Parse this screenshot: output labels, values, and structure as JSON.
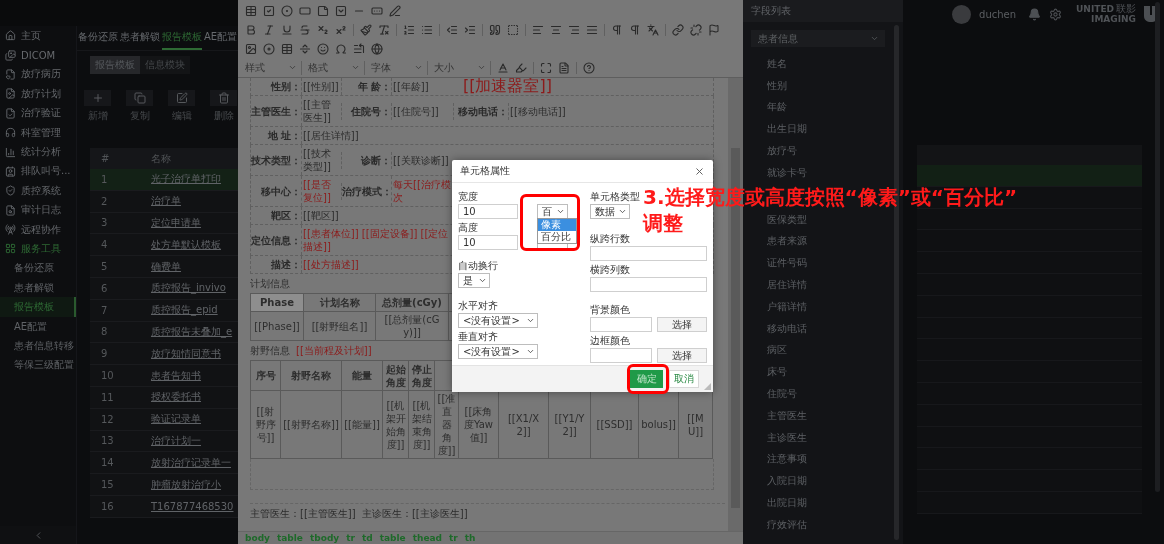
{
  "topbar": {
    "username": "duchen",
    "logo_top": "UNITED",
    "logo_cn": "联影",
    "logo_bottom": "IMAGING"
  },
  "nav": [
    {
      "label": "主页",
      "selected": false
    },
    {
      "label": "DICOM",
      "selected": false
    },
    {
      "label": "放疗病历",
      "selected": false
    },
    {
      "label": "放疗计划",
      "selected": false
    },
    {
      "label": "治疗验证",
      "selected": false
    },
    {
      "label": "科室管理",
      "selected": false
    },
    {
      "label": "统计分析",
      "selected": false
    },
    {
      "label": "排队叫号...",
      "selected": false
    },
    {
      "label": "质控系统",
      "selected": false
    },
    {
      "label": "审计日志",
      "selected": false
    },
    {
      "label": "远程协作",
      "selected": false
    },
    {
      "label": "服务工具",
      "selected": true,
      "children": [
        {
          "label": "备份还原",
          "selected": false
        },
        {
          "label": "患者解锁",
          "selected": false
        },
        {
          "label": "报告模板",
          "selected": true
        },
        {
          "label": "AE配置",
          "selected": false
        },
        {
          "label": "患者信息转移",
          "selected": false
        },
        {
          "label": "等保三级配置",
          "selected": false
        }
      ]
    }
  ],
  "tabs": [
    {
      "label": "备份还原",
      "selected": false
    },
    {
      "label": "患者解锁",
      "selected": false
    },
    {
      "label": "报告模板",
      "selected": true
    },
    {
      "label": "AE配置",
      "selected": false
    }
  ],
  "subtabs": [
    {
      "label": "报告模板",
      "selected": true
    },
    {
      "label": "信息模块",
      "selected": false
    }
  ],
  "actions": [
    "新增",
    "复制",
    "编辑",
    "删除"
  ],
  "template_table": {
    "columns": [
      "#",
      "名称"
    ],
    "rows": [
      {
        "index": "1",
        "name": "光子治疗单打印",
        "selected": true
      },
      {
        "index": "2",
        "name": "治疗单",
        "selected": false
      },
      {
        "index": "3",
        "name": "定位申请单",
        "selected": false
      },
      {
        "index": "4",
        "name": "处方单默认模板",
        "selected": false
      },
      {
        "index": "5",
        "name": "确费单",
        "selected": false
      },
      {
        "index": "6",
        "name": "质控报告_invivo",
        "selected": false
      },
      {
        "index": "7",
        "name": "质控报告_epid",
        "selected": false
      },
      {
        "index": "8",
        "name": "质控报告未叠加_e",
        "selected": false
      },
      {
        "index": "9",
        "name": "放疗知情同意书",
        "selected": false
      },
      {
        "index": "10",
        "name": "患者告知书",
        "selected": false
      },
      {
        "index": "11",
        "name": "授权委托书",
        "selected": false
      },
      {
        "index": "12",
        "name": "验证记录单",
        "selected": false
      },
      {
        "index": "13",
        "name": "治疗计划一",
        "selected": false
      },
      {
        "index": "14",
        "name": "放射治疗记录单一",
        "selected": false
      },
      {
        "index": "15",
        "name": "肿瘤放射治疗小",
        "selected": false
      },
      {
        "index": "16",
        "name": "T167877468530",
        "selected": false
      }
    ]
  },
  "editor": {
    "format_menus": [
      "样式",
      "格式",
      "字体",
      "大小"
    ],
    "info_rows": [
      {
        "cells": [
          {
            "kind": "field",
            "label": "性别：",
            "values": [
              "[[性别]]"
            ],
            "emphasis": false
          },
          {
            "kind": "field",
            "label": "年 龄：",
            "values": [
              "[[年龄]]"
            ],
            "emphasis": false
          },
          {
            "kind": "heading",
            "values": [
              "[[加速器室]]"
            ],
            "emphasis": true
          }
        ]
      },
      {
        "cells": [
          {
            "kind": "field",
            "label": "主管医生：",
            "values": [
              "[[主管医生]]"
            ],
            "emphasis": false
          },
          {
            "kind": "field",
            "label": "住院号：",
            "values": [
              "[[住院号]]"
            ],
            "emphasis": false
          },
          {
            "kind": "field",
            "label": "移动电话：",
            "values": [
              "[[移动电话]]"
            ],
            "emphasis": false
          }
        ]
      },
      {
        "cells": [
          {
            "kind": "field",
            "label": "地 址：",
            "values": [
              "[[居住详情]]"
            ],
            "emphasis": false
          }
        ]
      },
      {
        "cells": [
          {
            "kind": "field",
            "label": "技术类型：",
            "values": [
              "[[技术类型]]"
            ],
            "emphasis": false
          },
          {
            "kind": "field",
            "label": "诊断：",
            "values": [
              "[[关联诊断]]"
            ],
            "emphasis": false
          }
        ]
      },
      {
        "cells": [
          {
            "kind": "field",
            "label": "移中心：",
            "values": [
              "[[是否复位]]"
            ],
            "emphasis": true
          },
          {
            "kind": "field",
            "label": "治疗模式：",
            "values": [
              "每天[[治疗模",
              "次"
            ],
            "emphasis": true
          }
        ]
      },
      {
        "cells": [
          {
            "kind": "field",
            "label": "靶区：",
            "values": [
              "[[靶区]]"
            ],
            "emphasis": false
          }
        ]
      },
      {
        "cells": [
          {
            "kind": "field",
            "label": "定位信息：",
            "values": [
              "[[患者体位]]",
              "[[固定设备]]",
              "[[定位描述]]"
            ],
            "emphasis": true
          }
        ]
      },
      {
        "cells": [
          {
            "kind": "field",
            "label": "描述：",
            "values": [
              "[[处方描述]]"
            ],
            "emphasis": true
          }
        ]
      }
    ],
    "plan_label": "计划信息",
    "plan_table": {
      "columns": [
        {
          "label": "Phase",
          "selected": true
        },
        {
          "label": "计划名称",
          "selected": false
        },
        {
          "label": "总剂量(cGy)",
          "selected": false
        }
      ],
      "values": [
        "[[Phase]]",
        "[[射野组名]]",
        "[[总剂量(cGy)]]"
      ]
    },
    "beam_label": "射野信息",
    "beam_note": "[[当前程及计划]]",
    "beam_table": {
      "columns": [
        "序号",
        "射野名称",
        "能量",
        "起始角度",
        "停止角度"
      ],
      "values": [
        "[[射野序号]]",
        "[[射野名称]]",
        "[[能量]]",
        "[[机架开始角度]]",
        "[[机架结束角度]]",
        "[[准直器角度]]",
        "[[床角度Yaw值]]",
        "[[X1/X2]]",
        "[[Y1/Y2]]",
        "[[SSD]]",
        "bolus]]",
        "[[MU]]"
      ]
    },
    "footer_line": "主管医生：[[主管医生]]  主诊医生：[[主诊医生]]",
    "element_path": [
      "body",
      "table",
      "tbody",
      "tr",
      "td",
      "table",
      "thead",
      "tr",
      "th"
    ]
  },
  "field_panel": {
    "title": "字段列表",
    "category": "患者信息",
    "fields": [
      "姓名",
      "性别",
      "年龄",
      "出生日期",
      "放疗号",
      "就诊卡号",
      "医保类型",
      "患者来源",
      "证件号码",
      "居住详情",
      "户籍详情",
      "移动电话",
      "病区",
      "床号",
      "住院号",
      "主管医生",
      "主诊医生",
      "注意事项",
      "入院日期",
      "出院日期",
      "疗效评估"
    ]
  },
  "dialog": {
    "title": "单元格属性",
    "width_label": "宽度",
    "width_value": "10",
    "unit_select": {
      "value": "百",
      "open": true,
      "options": [
        {
          "label": "像素",
          "selected": true
        },
        {
          "label": "百分比",
          "selected": false
        }
      ]
    },
    "height_label": "高度",
    "height_value": "10",
    "wrap_label": "自动换行",
    "wrap_value": "是",
    "halign_label": "水平对齐",
    "halign_value": "<没有设置>",
    "valign_label": "垂直对齐",
    "valign_value": "<没有设置>",
    "celltype_label": "单元格类型",
    "celltype_value": "数据",
    "rowspan_label": "纵跨行数",
    "colspan_label": "横跨列数",
    "bg_label": "背景颜色",
    "bg_button": "选择",
    "border_label": "边框颜色",
    "border_button": "选择",
    "ok": "确定",
    "cancel": "取消"
  },
  "annotation_lines": [
    "3.选择宽度或高度按照“像素”或“百分比”",
    "调整"
  ]
}
